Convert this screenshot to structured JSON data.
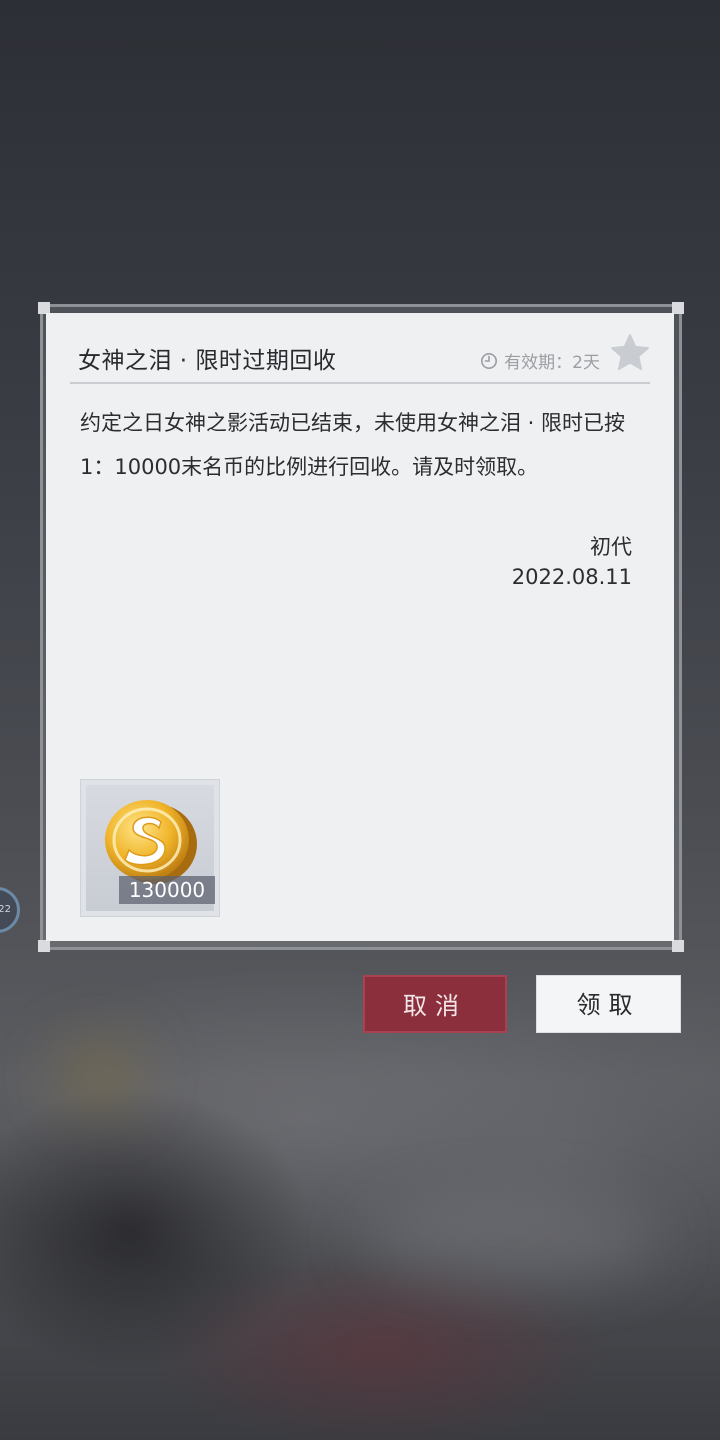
{
  "side_badge": {
    "text": "22"
  },
  "mail": {
    "title": "女神之泪 · 限时过期回收",
    "validity": "有效期：2天",
    "body": "约定之日女神之影活动已结束，未使用女神之泪 · 限时已按1：10000末名币的比例进行回收。请及时领取。",
    "sender": "初代",
    "date": "2022.08.11",
    "reward": {
      "icon": "gold-s-coin-icon",
      "count": "130000"
    }
  },
  "buttons": {
    "cancel_label": "取消",
    "claim_label": "领取"
  },
  "colors": {
    "cancel_button": "#8c2f3d",
    "claim_button": "#f4f5f6",
    "dialog_background": "#eef0f1",
    "coin_gold": "#e0a020"
  }
}
